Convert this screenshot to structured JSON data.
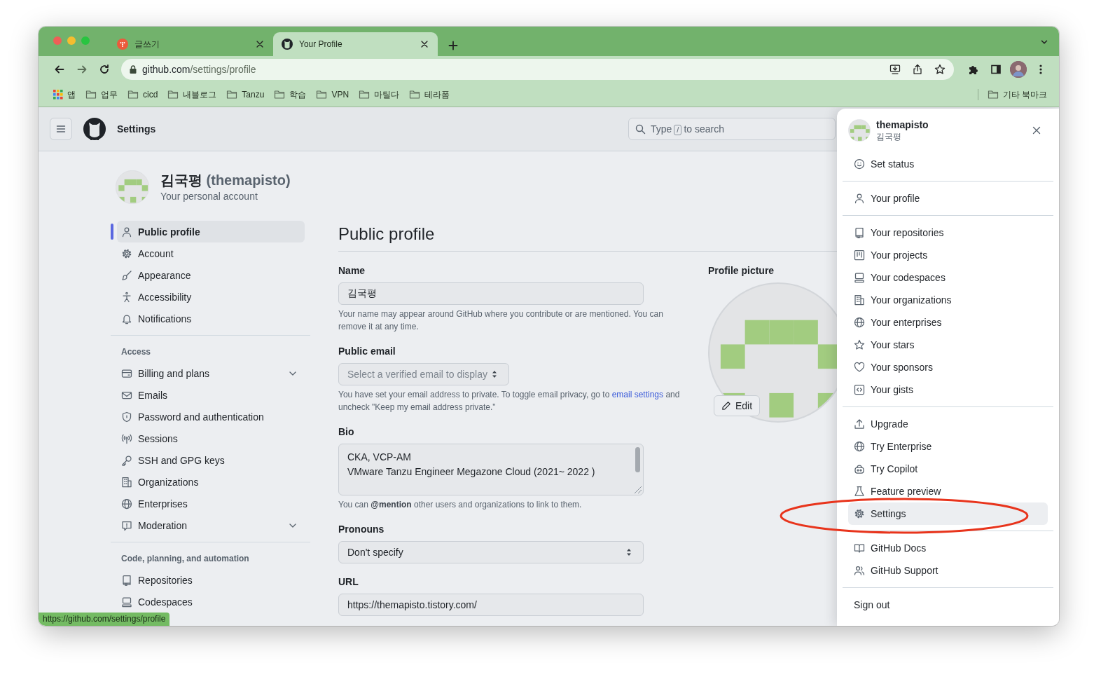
{
  "browser": {
    "tabs": [
      {
        "title": "글쓰기",
        "selected": false
      },
      {
        "title": "Your Profile",
        "selected": true
      }
    ],
    "address": {
      "host": "github.com",
      "path": "/settings/profile"
    },
    "bookmarks": [
      {
        "label": "앱",
        "kind": "apps"
      },
      {
        "label": "업무",
        "kind": "folder"
      },
      {
        "label": "cicd",
        "kind": "folder"
      },
      {
        "label": "내블로그",
        "kind": "folder"
      },
      {
        "label": "Tanzu",
        "kind": "folder"
      },
      {
        "label": "학습",
        "kind": "folder"
      },
      {
        "label": "VPN",
        "kind": "folder"
      },
      {
        "label": "마틸다",
        "kind": "folder"
      },
      {
        "label": "테라폼",
        "kind": "folder"
      }
    ],
    "other_bookmarks": "기타 북마크"
  },
  "header": {
    "title": "Settings",
    "search": {
      "before": "Type",
      "key": "/",
      "after": "to search"
    }
  },
  "account": {
    "name": "김국평",
    "login": "(themapisto)",
    "subtitle": "Your personal account"
  },
  "sidebar": {
    "sections": [
      {
        "items": [
          {
            "label": "Public profile",
            "kind": "link",
            "selected": true
          },
          {
            "label": "Account",
            "kind": "link",
            "selected": false
          },
          {
            "label": "Appearance",
            "kind": "link",
            "selected": false
          },
          {
            "label": "Accessibility",
            "kind": "link",
            "selected": false
          },
          {
            "label": "Notifications",
            "kind": "link",
            "selected": false
          }
        ]
      },
      {
        "heading": "Access",
        "items": [
          {
            "label": "Billing and plans",
            "kind": "group",
            "selected": false
          },
          {
            "label": "Emails",
            "kind": "link",
            "selected": false
          },
          {
            "label": "Password and authentication",
            "kind": "link",
            "selected": false
          },
          {
            "label": "Sessions",
            "kind": "link",
            "selected": false
          },
          {
            "label": "SSH and GPG keys",
            "kind": "link",
            "selected": false
          },
          {
            "label": "Organizations",
            "kind": "link",
            "selected": false
          },
          {
            "label": "Enterprises",
            "kind": "link",
            "selected": false
          },
          {
            "label": "Moderation",
            "kind": "group",
            "selected": false
          }
        ]
      },
      {
        "heading": "Code, planning, and automation",
        "items": [
          {
            "label": "Repositories",
            "kind": "link",
            "selected": false
          },
          {
            "label": "Codespaces",
            "kind": "link",
            "selected": false
          }
        ]
      }
    ]
  },
  "profile_form": {
    "title": "Public profile",
    "fields": [
      {
        "kind": "text",
        "label": "Name",
        "value": "김국평",
        "hint": "Your name may appear around GitHub where you contribute or are mentioned. You can remove it at any time."
      },
      {
        "kind": "select",
        "label": "Public email",
        "placeholder": "Select a verified email to display",
        "hint": "You have set your email address to private. To toggle email privacy, go to ",
        "hint_link": "email settings",
        "hint_after": " and uncheck \"Keep my email address private.\""
      },
      {
        "kind": "textarea",
        "label": "Bio",
        "lines": [
          "CKA, VCP-AM",
          "VMware Tanzu Engineer Megazone Cloud (2021~ 2022 )"
        ],
        "hint": "You can **@mention** other users and organizations to link to them."
      },
      {
        "kind": "select",
        "label": "Pronouns",
        "value": "Don't specify"
      },
      {
        "kind": "text",
        "label": "URL",
        "value": "https://themapisto.tistory.com/"
      }
    ]
  },
  "profile_picture": {
    "label": "Profile picture",
    "edit_button": "Edit"
  },
  "user_menu": {
    "username": "themapisto",
    "name": "김국평",
    "groups": [
      [
        {
          "label": "Set status",
          "selected": false
        }
      ],
      [
        {
          "label": "Your profile",
          "selected": false
        }
      ],
      [
        {
          "label": "Your repositories",
          "selected": false
        },
        {
          "label": "Your projects",
          "selected": false
        },
        {
          "label": "Your codespaces",
          "selected": false
        },
        {
          "label": "Your organizations",
          "selected": false
        },
        {
          "label": "Your enterprises",
          "selected": false
        },
        {
          "label": "Your stars",
          "selected": false
        },
        {
          "label": "Your sponsors",
          "selected": false
        },
        {
          "label": "Your gists",
          "selected": false
        }
      ],
      [
        {
          "label": "Upgrade",
          "selected": false
        },
        {
          "label": "Try Enterprise",
          "selected": false
        },
        {
          "label": "Try Copilot",
          "selected": false
        },
        {
          "label": "Feature preview",
          "selected": false
        },
        {
          "label": "Settings",
          "selected": true
        }
      ],
      [
        {
          "label": "GitHub Docs",
          "selected": false
        },
        {
          "label": "GitHub Support",
          "selected": false
        }
      ]
    ],
    "sign_out": "Sign out"
  },
  "status_url": "https://github.com/settings/profile",
  "annotation": {
    "kind": "ellipse"
  }
}
